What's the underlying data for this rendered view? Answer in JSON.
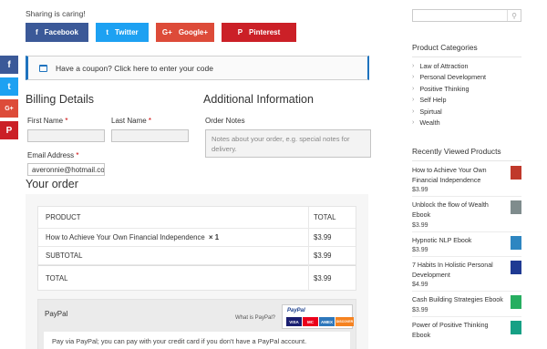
{
  "share": {
    "caring": "Sharing is caring!",
    "buttons": [
      {
        "label": "Facebook",
        "icon": "f",
        "color": "#3b5998"
      },
      {
        "label": "Twitter",
        "icon": "t",
        "color": "#1da1f2"
      },
      {
        "label": "Google+",
        "icon": "G+",
        "color": "#dd4b39"
      },
      {
        "label": "Pinterest",
        "icon": "P",
        "color": "#cb2027"
      }
    ],
    "side": [
      {
        "icon": "f",
        "color": "#3b5998"
      },
      {
        "icon": "t",
        "color": "#1da1f2"
      },
      {
        "icon": "G+",
        "color": "#dd4b39"
      },
      {
        "icon": "P",
        "color": "#cb2027"
      }
    ]
  },
  "coupon": {
    "text": "Have a coupon? Click here to enter your code"
  },
  "billing": {
    "heading": "Billing Details",
    "first_name_label": "First Name",
    "last_name_label": "Last Name",
    "email_label": "Email Address",
    "email_value": "averonnie@hotmail.co",
    "required_mark": "*"
  },
  "additional": {
    "heading": "Additional Information",
    "notes_label": "Order Notes",
    "notes_placeholder": "Notes about your order, e.g. special notes for delivery."
  },
  "order": {
    "heading": "Your order",
    "col_product": "PRODUCT",
    "col_total": "TOTAL",
    "item_name": "How to Achieve Your Own Financial Independence",
    "item_qty": "× 1",
    "item_total": "$3.99",
    "subtotal_label": "SUBTOTAL",
    "subtotal_value": "$3.99",
    "total_label": "TOTAL",
    "total_value": "$3.99"
  },
  "payment": {
    "method": "PayPal",
    "what_is": "What is PayPal?",
    "logo_text": "PayPal",
    "cards": [
      "VISA",
      "MC",
      "AMEX",
      "DISCOVER"
    ],
    "description": "Pay via PayPal; you can pay with your credit card if you don't have a PayPal account."
  },
  "sidebar": {
    "categories_heading": "Product Categories",
    "categories": [
      "Law of Attraction",
      "Personal Development",
      "Positive Thinking",
      "Self Help",
      "Spirtual",
      "Wealth"
    ],
    "recent_heading": "Recently Viewed Products",
    "recent": [
      {
        "title": "How to Achieve Your Own Financial Independence",
        "price": "$3.99",
        "thumb": "#c0392b"
      },
      {
        "title": "Unblock the flow of Wealth Ebook",
        "price": "$3.99",
        "thumb": "#7f8c8d"
      },
      {
        "title": "Hypnotic NLP Ebook",
        "price": "$3.99",
        "thumb": "#2e86c1"
      },
      {
        "title": "7 Habits In Holistic Personal Development",
        "price": "$4.99",
        "thumb": "#1f3a93"
      },
      {
        "title": "Cash Building Strategies Ebook",
        "price": "$3.99",
        "thumb": "#27ae60"
      },
      {
        "title": "Power of Positive Thinking Ebook",
        "price": "",
        "thumb": "#16a085"
      }
    ]
  }
}
